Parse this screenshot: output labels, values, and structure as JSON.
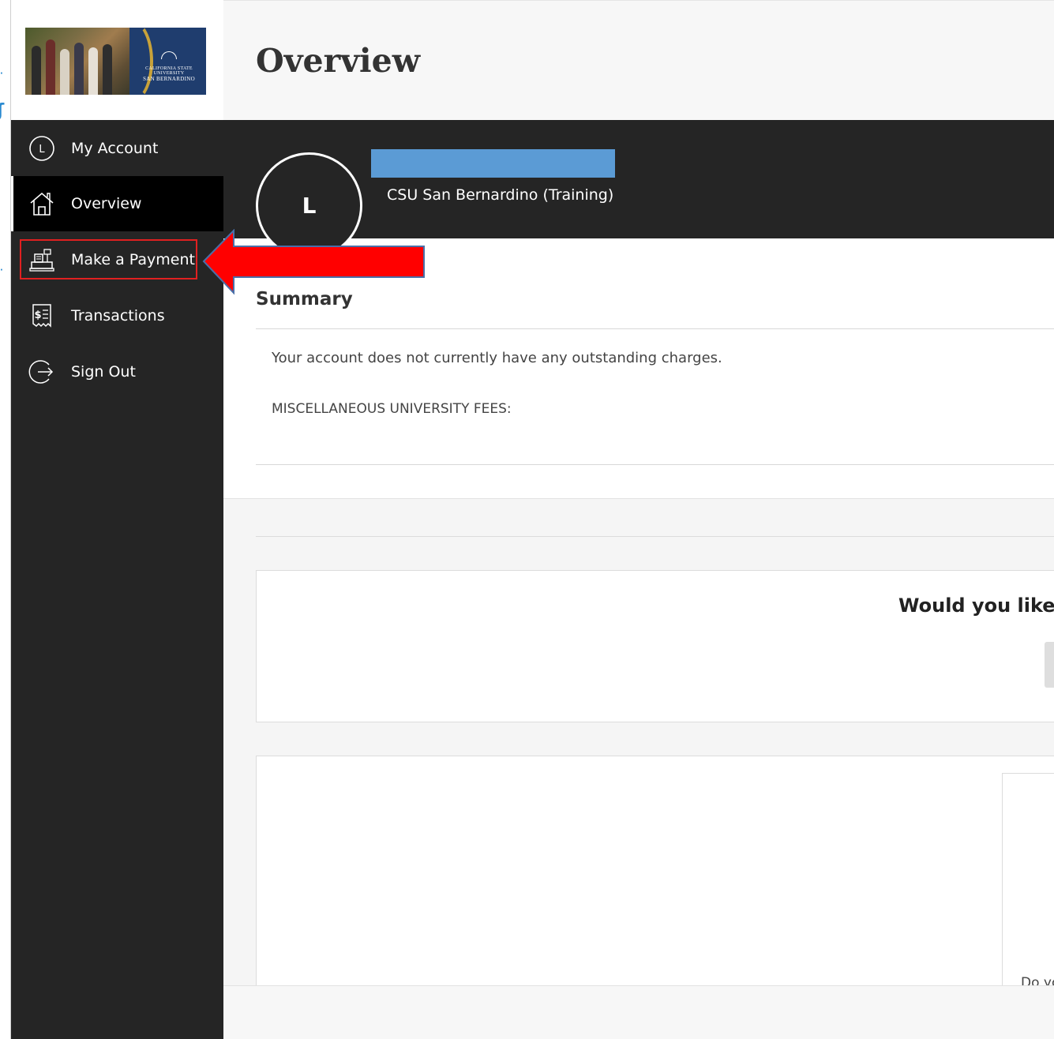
{
  "header": {
    "title": "Overview"
  },
  "logo": {
    "text_line1": "CALIFORNIA STATE UNIVERSITY",
    "text_line2": "SAN BERNARDINO"
  },
  "sidebar": {
    "items": [
      {
        "label": "My Account",
        "icon": "user-initial-icon",
        "icon_text": "L"
      },
      {
        "label": "Overview",
        "icon": "home-icon"
      },
      {
        "label": "Make a Payment",
        "icon": "cash-register-icon"
      },
      {
        "label": "Transactions",
        "icon": "receipt-icon"
      },
      {
        "label": "Sign Out",
        "icon": "sign-out-icon"
      }
    ],
    "active": "Overview",
    "highlighted": "Make a Payment"
  },
  "profile": {
    "avatar_letter": "L",
    "institution": "CSU San Bernardino (Training)"
  },
  "summary": {
    "title": "Summary",
    "message": "Your account does not currently have any outstanding charges.",
    "misc_fees_label": "MISCELLANEOUS UNIVERSITY FEES:"
  },
  "prompt_card": {
    "text": "Would you like to"
  },
  "lower_card": {
    "text": "Do yo"
  },
  "colors": {
    "sidebar_bg": "#252525",
    "active_item_bg": "#000000",
    "redaction": "#5b9bd5",
    "annotation_red": "#e02020"
  }
}
